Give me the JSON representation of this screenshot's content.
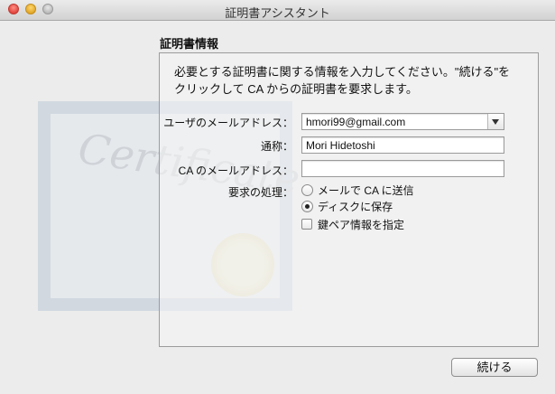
{
  "window": {
    "title": "証明書アシスタント"
  },
  "section": {
    "heading": "証明書情報"
  },
  "intro": {
    "line1": "必要とする証明書に関する情報を入力してください。\"続ける\"を",
    "line2": "クリックして CA からの証明書を要求します。"
  },
  "form": {
    "email": {
      "label": "ユーザのメールアドレス：",
      "value": "hmori99@gmail.com"
    },
    "common_name": {
      "label": "通称：",
      "value": "Mori Hidetoshi"
    },
    "ca_email": {
      "label": "CA のメールアドレス：",
      "value": ""
    },
    "request": {
      "label": "要求の処理：",
      "options": [
        {
          "label": "メールで CA に送信",
          "selected": false
        },
        {
          "label": "ディスクに保存",
          "selected": true
        }
      ]
    },
    "keypair": {
      "label": "鍵ペア情報を指定",
      "checked": false
    }
  },
  "decor": {
    "certificate_script": "Certificate"
  },
  "buttons": {
    "continue": "続ける"
  }
}
